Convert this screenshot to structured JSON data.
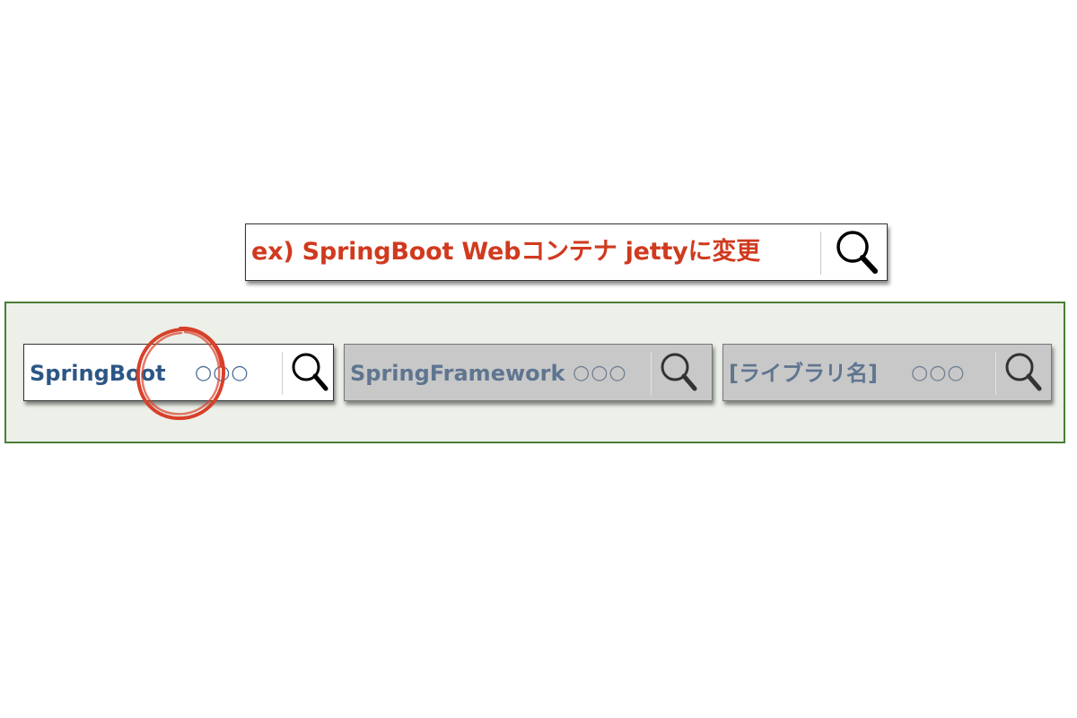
{
  "example": {
    "query": "ex) SpringBoot Webコンテナ jettyに変更",
    "search_icon": "magnifier-icon"
  },
  "search_boxes": [
    {
      "term": "SpringBoot",
      "placeholder": "○○○",
      "state": "active",
      "search_icon": "magnifier-icon"
    },
    {
      "term": "SpringFramework",
      "placeholder": "○○○",
      "state": "inactive",
      "search_icon": "magnifier-icon"
    },
    {
      "term": "[ライブラリ名]",
      "placeholder": "○○○",
      "state": "inactive",
      "search_icon": "magnifier-icon"
    }
  ],
  "colors": {
    "example_text": "#d03a1f",
    "active_term": "#2d5685",
    "inactive_term": "#5f7590",
    "panel_background": "#ecf0e9",
    "panel_border": "#4a7d36",
    "highlight_circle": "#d8402a"
  },
  "annotation": {
    "icon": "red-hand-drawn-circle"
  }
}
